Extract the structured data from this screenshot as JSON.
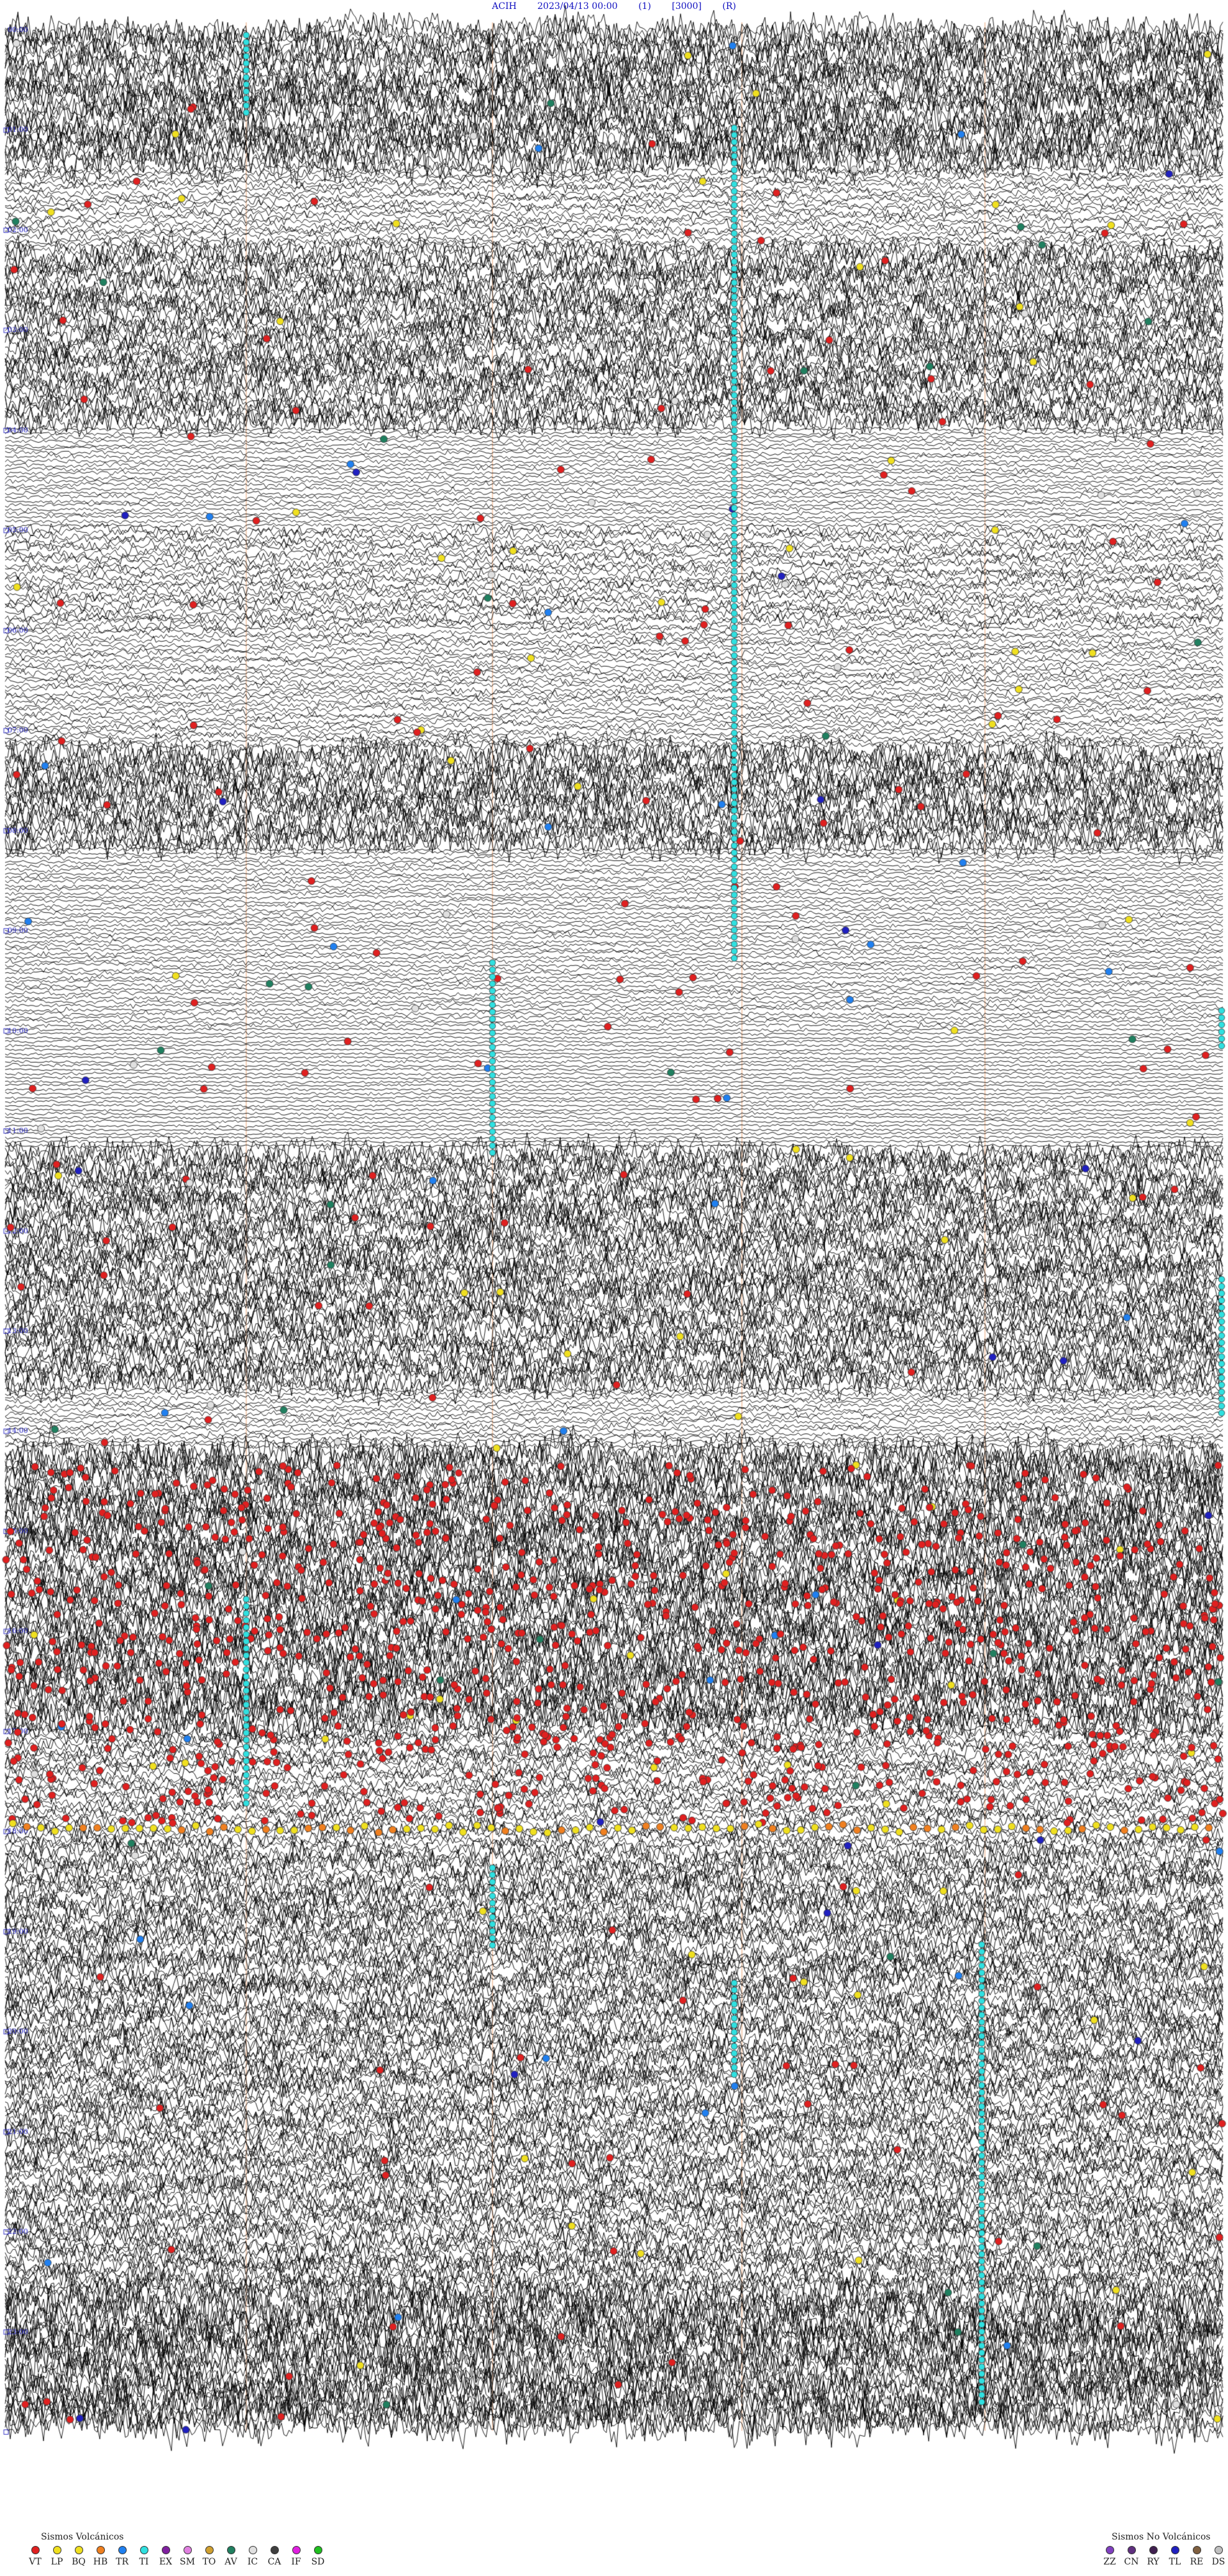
{
  "header": {
    "station": "ACIH",
    "datetime": "2023/04/13 00:00",
    "channel": "(1)",
    "scale": "[3000]",
    "flag": "(R)"
  },
  "chart_data": {
    "type": "line",
    "description_codes": true,
    "row_labels": [
      "00:00",
      "01:00",
      "02:00",
      "03:00",
      "04:00",
      "05:00",
      "06:00",
      "07:00",
      "08:00",
      "09:00",
      "10:00",
      "11:00",
      "12:00",
      "13:00",
      "14:00",
      "15:00",
      "16:00",
      "17:00",
      "18:00",
      "19:00",
      "20:00",
      "21:00",
      "22:00",
      "23:00"
    ],
    "bands": [
      {
        "from": 0,
        "to": 35,
        "amp": 40
      },
      {
        "from": 35,
        "to": 55,
        "amp": 12
      },
      {
        "from": 55,
        "to": 100,
        "amp": 32
      },
      {
        "from": 100,
        "to": 125,
        "amp": 6
      },
      {
        "from": 125,
        "to": 150,
        "amp": 14
      },
      {
        "from": 150,
        "to": 180,
        "amp": 9
      },
      {
        "from": 180,
        "to": 205,
        "amp": 36
      },
      {
        "from": 205,
        "to": 250,
        "amp": 6
      },
      {
        "from": 250,
        "to": 280,
        "amp": 4
      },
      {
        "from": 280,
        "to": 340,
        "amp": 34
      },
      {
        "from": 340,
        "to": 355,
        "amp": 8
      },
      {
        "from": 355,
        "to": 425,
        "amp": 42
      },
      {
        "from": 425,
        "to": 455,
        "amp": 20
      },
      {
        "from": 455,
        "to": 510,
        "amp": 30
      },
      {
        "from": 510,
        "to": 565,
        "amp": 28
      },
      {
        "from": 565,
        "to": 600,
        "amp": 46
      }
    ],
    "legend_volcanic": {
      "title": "Sismos Volcánicos",
      "items": [
        {
          "code": "VT",
          "color": "#e02020"
        },
        {
          "code": "LP",
          "color": "#f0e020"
        },
        {
          "code": "BQ",
          "color": "#f0e020"
        },
        {
          "code": "HB",
          "color": "#f08020"
        },
        {
          "code": "TR",
          "color": "#2080f0"
        },
        {
          "code": "TI",
          "color": "#30e0e0"
        },
        {
          "code": "EX",
          "color": "#8020a0"
        },
        {
          "code": "SM",
          "color": "#e080e0"
        },
        {
          "code": "TO",
          "color": "#d0a030"
        },
        {
          "code": "AV",
          "color": "#208060"
        },
        {
          "code": "IC",
          "color": "#e0e0e0"
        },
        {
          "code": "CA",
          "color": "#404040"
        },
        {
          "code": "IF",
          "color": "#e020e0"
        },
        {
          "code": "SD",
          "color": "#20c020"
        }
      ]
    },
    "legend_nonvolcanic": {
      "title": "Sismos No Volcánicos",
      "items": [
        {
          "code": "ZZ",
          "color": "#8040c0"
        },
        {
          "code": "CN",
          "color": "#603080"
        },
        {
          "code": "RY",
          "color": "#402050"
        },
        {
          "code": "TL",
          "color": "#2020c0"
        },
        {
          "code": "RE",
          "color": "#806040"
        },
        {
          "code": "DS",
          "color": "#c0c0c0"
        }
      ]
    }
  }
}
